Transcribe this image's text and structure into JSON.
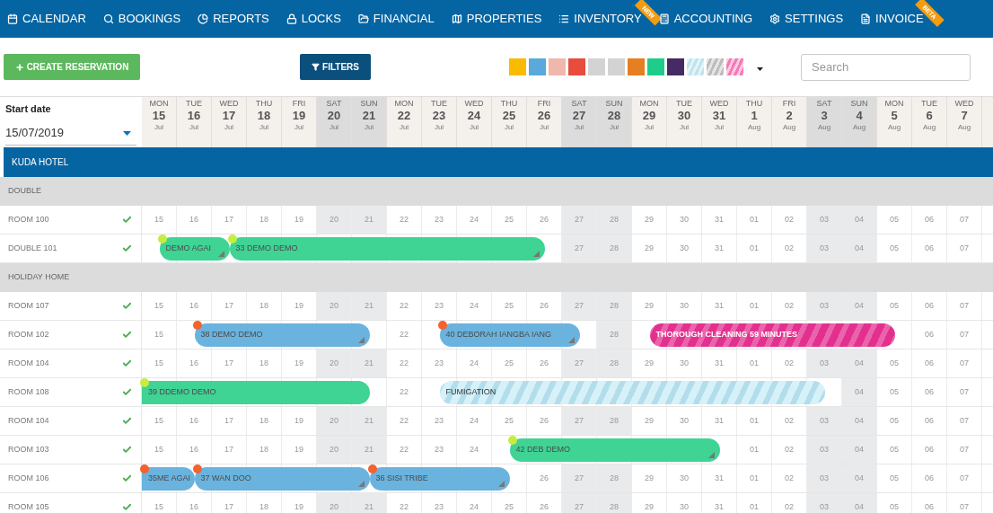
{
  "nav": [
    {
      "label": "CALENDAR"
    },
    {
      "label": "BOOKINGS"
    },
    {
      "label": "REPORTS"
    },
    {
      "label": "LOCKS"
    },
    {
      "label": "FINANCIAL"
    },
    {
      "label": "PROPERTIES"
    },
    {
      "label": "INVENTORY",
      "ribbon": "NEW"
    },
    {
      "label": "ACCOUNTING"
    },
    {
      "label": "SETTINGS"
    },
    {
      "label": "INVOICE",
      "ribbon": "BETA"
    }
  ],
  "toolbar": {
    "create_button": "CREATE RESERVATION",
    "filters_button": "FILTERS",
    "search": {
      "placeholder": "Search"
    },
    "swatches": [
      {
        "kind": "solid",
        "color": "#f8bb00"
      },
      {
        "kind": "solid",
        "color": "#5aa9dc"
      },
      {
        "kind": "solid",
        "color": "#f0b7ad"
      },
      {
        "kind": "solid",
        "color": "#e74c3c"
      },
      {
        "kind": "solid",
        "color": "#d3d3d3"
      },
      {
        "kind": "solid",
        "color": "#d3d3d3"
      },
      {
        "kind": "solid",
        "color": "#e67e22"
      },
      {
        "kind": "solid",
        "color": "#1fcc8a"
      },
      {
        "kind": "solid",
        "color": "#452a63"
      },
      {
        "kind": "striped",
        "color": "#bfe3ee"
      },
      {
        "kind": "striped",
        "color": "#bdbdbd"
      },
      {
        "kind": "striped",
        "color": "#f37bb6"
      }
    ]
  },
  "start_date": {
    "label": "Start date",
    "value": "15/07/2019"
  },
  "days": [
    {
      "weekday": "MON",
      "day": "15",
      "month": "Jul",
      "weekend": false
    },
    {
      "weekday": "TUE",
      "day": "16",
      "month": "Jul",
      "weekend": false
    },
    {
      "weekday": "WED",
      "day": "17",
      "month": "Jul",
      "weekend": false
    },
    {
      "weekday": "THU",
      "day": "18",
      "month": "Jul",
      "weekend": false
    },
    {
      "weekday": "FRI",
      "day": "19",
      "month": "Jul",
      "weekend": false
    },
    {
      "weekday": "SAT",
      "day": "20",
      "month": "Jul",
      "weekend": true
    },
    {
      "weekday": "SUN",
      "day": "21",
      "month": "Jul",
      "weekend": true
    },
    {
      "weekday": "MON",
      "day": "22",
      "month": "Jul",
      "weekend": false
    },
    {
      "weekday": "TUE",
      "day": "23",
      "month": "Jul",
      "weekend": false
    },
    {
      "weekday": "WED",
      "day": "24",
      "month": "Jul",
      "weekend": false
    },
    {
      "weekday": "THU",
      "day": "25",
      "month": "Jul",
      "weekend": false
    },
    {
      "weekday": "FRI",
      "day": "26",
      "month": "Jul",
      "weekend": false
    },
    {
      "weekday": "SAT",
      "day": "27",
      "month": "Jul",
      "weekend": true
    },
    {
      "weekday": "SUN",
      "day": "28",
      "month": "Jul",
      "weekend": true
    },
    {
      "weekday": "MON",
      "day": "29",
      "month": "Jul",
      "weekend": false
    },
    {
      "weekday": "TUE",
      "day": "30",
      "month": "Jul",
      "weekend": false
    },
    {
      "weekday": "WED",
      "day": "31",
      "month": "Jul",
      "weekend": false
    },
    {
      "weekday": "THU",
      "day": "1",
      "month": "Aug",
      "weekend": false
    },
    {
      "weekday": "FRI",
      "day": "2",
      "month": "Aug",
      "weekend": false
    },
    {
      "weekday": "SAT",
      "day": "3",
      "month": "Aug",
      "weekend": true
    },
    {
      "weekday": "SUN",
      "day": "4",
      "month": "Aug",
      "weekend": true
    },
    {
      "weekday": "MON",
      "day": "5",
      "month": "Aug",
      "weekend": false
    },
    {
      "weekday": "TUE",
      "day": "6",
      "month": "Aug",
      "weekend": false
    },
    {
      "weekday": "WED",
      "day": "7",
      "month": "Aug",
      "weekend": false
    }
  ],
  "hotel": "KUDA HOTEL",
  "groups": [
    {
      "name": "DOUBLE",
      "rooms": [
        {
          "name": "ROOM 100",
          "cells": [
            "15",
            "16",
            "17",
            "18",
            "19",
            "20",
            "21",
            "22",
            "23",
            "24",
            "25",
            "26",
            "27",
            "28",
            "29",
            "30",
            "31",
            "01",
            "02",
            "03",
            "04",
            "05",
            "06",
            "07"
          ]
        },
        {
          "name": "DOUBLE 101",
          "cells": [
            {
              "kind": "booked",
              "booking": {
                "kind": "reservation",
                "label": "DEMO AGAI",
                "color": "#3fd394",
                "dot": {
                  "color": "#c5ec3f"
                },
                "resizable": true,
                "clipped_left": false
              }
            },
            {
              "kind": "booked"
            },
            {
              "kind": "booked",
              "booking": {
                "kind": "reservation",
                "label": "33  DEMO DEMO",
                "color": "#3fd394",
                "dot": {
                  "color": "#c5ec3f"
                },
                "resizable": true,
                "clipped_left": false
              }
            },
            {
              "kind": "booked"
            },
            {
              "kind": "booked"
            },
            {
              "kind": "booked"
            },
            {
              "kind": "booked"
            },
            {
              "kind": "booked"
            },
            {
              "kind": "booked"
            },
            {
              "kind": "booked"
            },
            {
              "kind": "booked"
            },
            {
              "kind": "booked"
            },
            "27",
            "28",
            "29",
            "30",
            "31",
            "01",
            "02",
            "03",
            "04",
            "05",
            "06",
            "07"
          ]
        }
      ]
    },
    {
      "name": "HOLIDAY HOME",
      "rooms": [
        {
          "name": "ROOM 107",
          "cells": [
            "15",
            "16",
            "17",
            "18",
            "19",
            "20",
            "21",
            "22",
            "23",
            "24",
            "25",
            "26",
            "27",
            "28",
            "29",
            "30",
            "31",
            "01",
            "02",
            "03",
            "04",
            "05",
            "06",
            "07"
          ]
        },
        {
          "name": "ROOM 102",
          "cells": [
            "15",
            {
              "kind": "booked",
              "booking": {
                "kind": "reservation",
                "label": "38  DEMO DEMO",
                "color": "#6ab3de",
                "dot": {
                  "color": "#f4622e"
                },
                "resizable": true,
                "clipped_left": false
              }
            },
            {
              "kind": "booked"
            },
            {
              "kind": "booked"
            },
            {
              "kind": "booked"
            },
            {
              "kind": "booked"
            },
            {
              "kind": "booked"
            },
            "22",
            {
              "kind": "booked",
              "booking": {
                "kind": "reservation",
                "label": "40  DEBORAH IANGBA IANG",
                "color": "#6ab3de",
                "dot": {
                  "color": "#f4622e"
                },
                "resizable": true,
                "clipped_left": false
              }
            },
            {
              "kind": "booked"
            },
            {
              "kind": "booked"
            },
            {
              "kind": "booked"
            },
            {
              "kind": "booked"
            },
            "28",
            {
              "kind": "booked",
              "booking": {
                "kind": "block",
                "label": "THOROUGH CLEANING 59 MINUTES",
                "color": "#e3308f",
                "resizable": false,
                "clipped_left": false
              }
            },
            {
              "kind": "booked"
            },
            {
              "kind": "booked"
            },
            {
              "kind": "booked"
            },
            {
              "kind": "booked"
            },
            {
              "kind": "booked"
            },
            {
              "kind": "booked"
            },
            {
              "kind": "booked"
            },
            "06",
            "07"
          ]
        },
        {
          "name": "ROOM 104",
          "cells": [
            "15",
            "16",
            "17",
            "18",
            "19",
            "20",
            "21",
            "22",
            "23",
            "24",
            "25",
            "26",
            "27",
            "28",
            "29",
            "30",
            "31",
            "01",
            "02",
            "03",
            "04",
            "05",
            "06",
            "07"
          ]
        },
        {
          "name": "ROOM 108",
          "cells": [
            {
              "kind": "booked",
              "booking": {
                "kind": "reservation",
                "label": "39  DDEMO DEMO",
                "color": "#3fd394",
                "dot": {
                  "color": "#c5ec3f"
                },
                "resizable": false,
                "clipped_left": true
              }
            },
            {
              "kind": "booked"
            },
            {
              "kind": "booked"
            },
            {
              "kind": "booked"
            },
            {
              "kind": "booked"
            },
            {
              "kind": "booked"
            },
            {
              "kind": "booked"
            },
            "22",
            {
              "kind": "booked",
              "booking": {
                "kind": "block",
                "label": "FUMIGATION",
                "color": "#d6f1f8",
                "resizable": false,
                "clipped_left": false
              }
            },
            {
              "kind": "booked"
            },
            {
              "kind": "booked"
            },
            {
              "kind": "booked"
            },
            {
              "kind": "booked"
            },
            {
              "kind": "booked"
            },
            {
              "kind": "booked"
            },
            {
              "kind": "booked"
            },
            {
              "kind": "booked"
            },
            {
              "kind": "booked"
            },
            {
              "kind": "booked"
            },
            {
              "kind": "booked"
            },
            "04",
            "05",
            "06",
            "07"
          ]
        },
        {
          "name": "ROOM 104",
          "cells": [
            "15",
            "16",
            "17",
            "18",
            "19",
            "20",
            "21",
            "22",
            "23",
            "24",
            "25",
            "26",
            "27",
            "28",
            "29",
            "30",
            "31",
            "01",
            "02",
            "03",
            "04",
            "05",
            "06",
            "07"
          ]
        },
        {
          "name": "ROOM 103",
          "cells": [
            "15",
            "16",
            "17",
            "18",
            "19",
            "20",
            "21",
            "22",
            "23",
            "24",
            {
              "kind": "booked",
              "booking": {
                "kind": "reservation",
                "label": "42  DEB DEMO",
                "color": "#3fd394",
                "dot": {
                  "color": "#c5ec3f"
                },
                "resizable": true,
                "clipped_left": false
              }
            },
            {
              "kind": "booked"
            },
            {
              "kind": "booked"
            },
            {
              "kind": "booked"
            },
            {
              "kind": "booked"
            },
            {
              "kind": "booked"
            },
            {
              "kind": "booked"
            },
            "01",
            "02",
            "03",
            "04",
            "05",
            "06",
            "07"
          ]
        },
        {
          "name": "ROOM 106",
          "cells": [
            {
              "kind": "booked",
              "booking": {
                "kind": "reservation",
                "label": "35ME AGAI",
                "color": "#6ab3de",
                "dot": {
                  "color": "#f4622e"
                },
                "resizable": false,
                "clipped_left": true
              }
            },
            {
              "kind": "booked",
              "booking": {
                "kind": "reservation",
                "label": "37  WAN DOO",
                "color": "#6ab3de",
                "dot": {
                  "color": "#f4622e"
                },
                "resizable": true,
                "clipped_left": false
              }
            },
            {
              "kind": "booked"
            },
            {
              "kind": "booked"
            },
            {
              "kind": "booked"
            },
            {
              "kind": "booked"
            },
            {
              "kind": "booked",
              "booking": {
                "kind": "reservation",
                "label": "36  SISI TRIBE",
                "color": "#6ab3de",
                "dot": {
                  "color": "#f4622e"
                },
                "resizable": true,
                "clipped_left": false
              }
            },
            {
              "kind": "booked"
            },
            {
              "kind": "booked"
            },
            {
              "kind": "booked"
            },
            {
              "kind": "booked"
            },
            "26",
            "27",
            "28",
            "29",
            "30",
            "31",
            "01",
            "02",
            "03",
            "04",
            "05",
            "06",
            "07"
          ]
        },
        {
          "name": "ROOM 105",
          "cells": [
            "15",
            "16",
            "17",
            "18",
            "19",
            "20",
            "21",
            "22",
            "23",
            "24",
            "25",
            "26",
            "27",
            "28",
            "29",
            "30",
            "31",
            "01",
            "02",
            "03",
            "04",
            "05",
            "06",
            "07"
          ]
        }
      ]
    }
  ]
}
